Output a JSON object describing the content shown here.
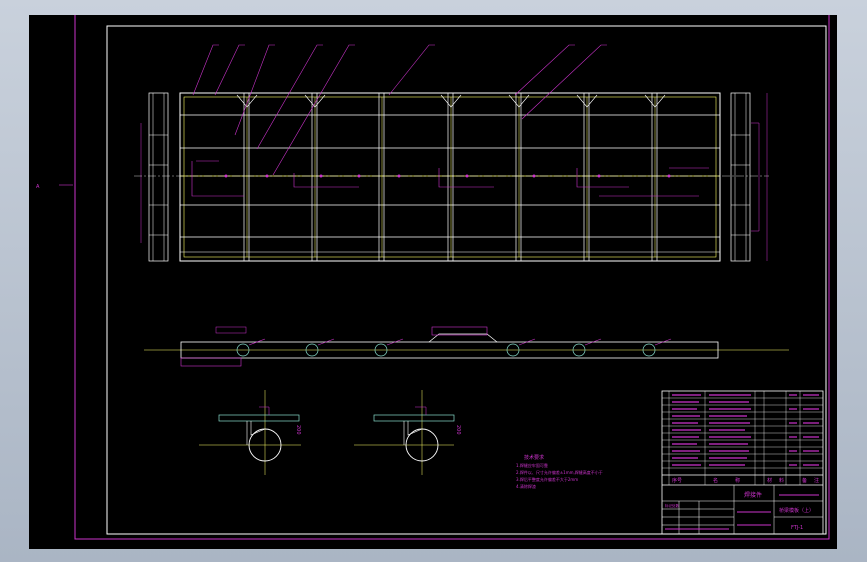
{
  "drawing": {
    "title_block": {
      "part_name": "焊接件",
      "assembly_name": "桥梁模板（上）",
      "drawing_number": "FTJ-1",
      "header_cells": [
        "序号",
        "名",
        "称",
        "材",
        "料",
        "备",
        "注"
      ],
      "bom_rows": 11,
      "bottom_left_label": "标记处数"
    },
    "tech_notes": {
      "heading": "技术要求",
      "lines": [
        "1.焊缝应牢固可靠",
        "2.焊件以、尺寸允许偏差±1mm,焊缝高度不小于",
        "3.焊后平整度允许偏差不大于2mm",
        "4.清除焊渣"
      ]
    },
    "dims": {
      "left_marker": "A",
      "section_dim": "200"
    }
  }
}
